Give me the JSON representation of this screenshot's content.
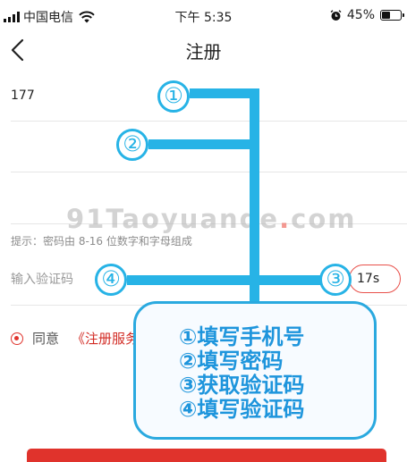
{
  "status_bar": {
    "carrier": "中国电信",
    "time": "下午 5:35",
    "battery": "45%",
    "battery_level": 0.45
  },
  "nav": {
    "title": "注册"
  },
  "form": {
    "phone_value": "177",
    "password_value": "",
    "confirm_value": "",
    "password_hint": "提示：密码由 8-16 位数字和字母组成",
    "code_placeholder": "输入验证码",
    "code_button_label": "17s",
    "agree_text": "同意",
    "terms_link": "《注册服务"
  },
  "watermark": {
    "text_prefix": "91Taoyuande",
    "text_dot": ".",
    "text_suffix": "com"
  },
  "overlay": {
    "badges": [
      "①",
      "②",
      "④",
      "③"
    ],
    "steps": [
      "①填写手机号",
      "②填写密码",
      "③获取验证码",
      "④填写验证码"
    ],
    "accent_color": "#27b3e6"
  }
}
